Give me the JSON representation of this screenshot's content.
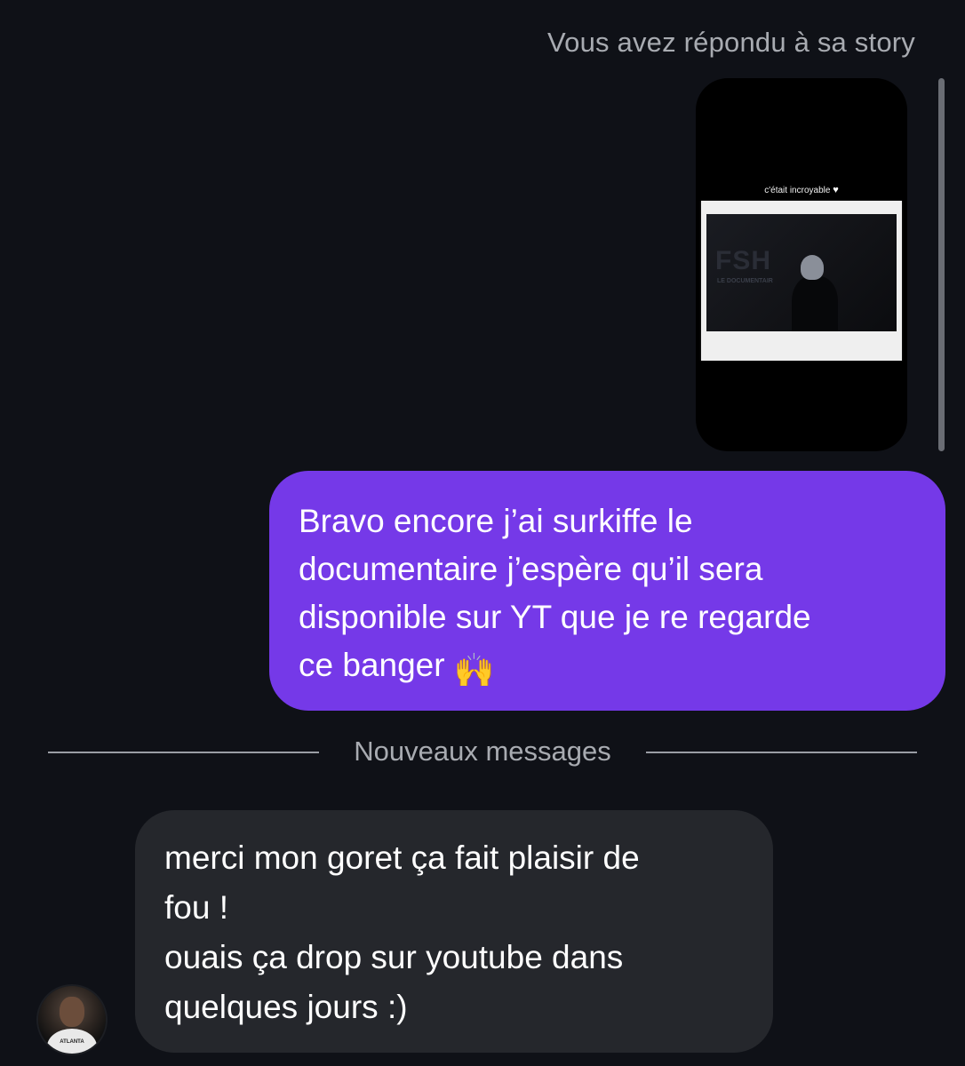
{
  "conversation": {
    "story_reply_caption": "Vous avez répondu à sa story",
    "story": {
      "caption": "c'était incroyable",
      "heart_icon": "white-heart",
      "poster_text": "FSH",
      "poster_subtext": "LE DOCUMENTAIR"
    },
    "sent_message": {
      "lines": [
        "Bravo encore j’ai surkiffe le",
        "documentaire j’espère qu’il sera",
        "disponible sur YT que je re regarde",
        "ce banger"
      ],
      "emoji": "🙌"
    },
    "new_messages_divider": "Nouveaux messages",
    "received_message": {
      "lines": [
        "merci mon goret ça fait plaisir de",
        "fou !",
        "ouais ça drop sur youtube dans",
        "quelques jours :)"
      ]
    },
    "avatar": {
      "shirt_text": "ATLANTA"
    }
  },
  "colors": {
    "background": "#0f1117",
    "sent_bubble": "#7539e8",
    "received_bubble": "#25272c",
    "muted_text": "#a8abb1"
  }
}
